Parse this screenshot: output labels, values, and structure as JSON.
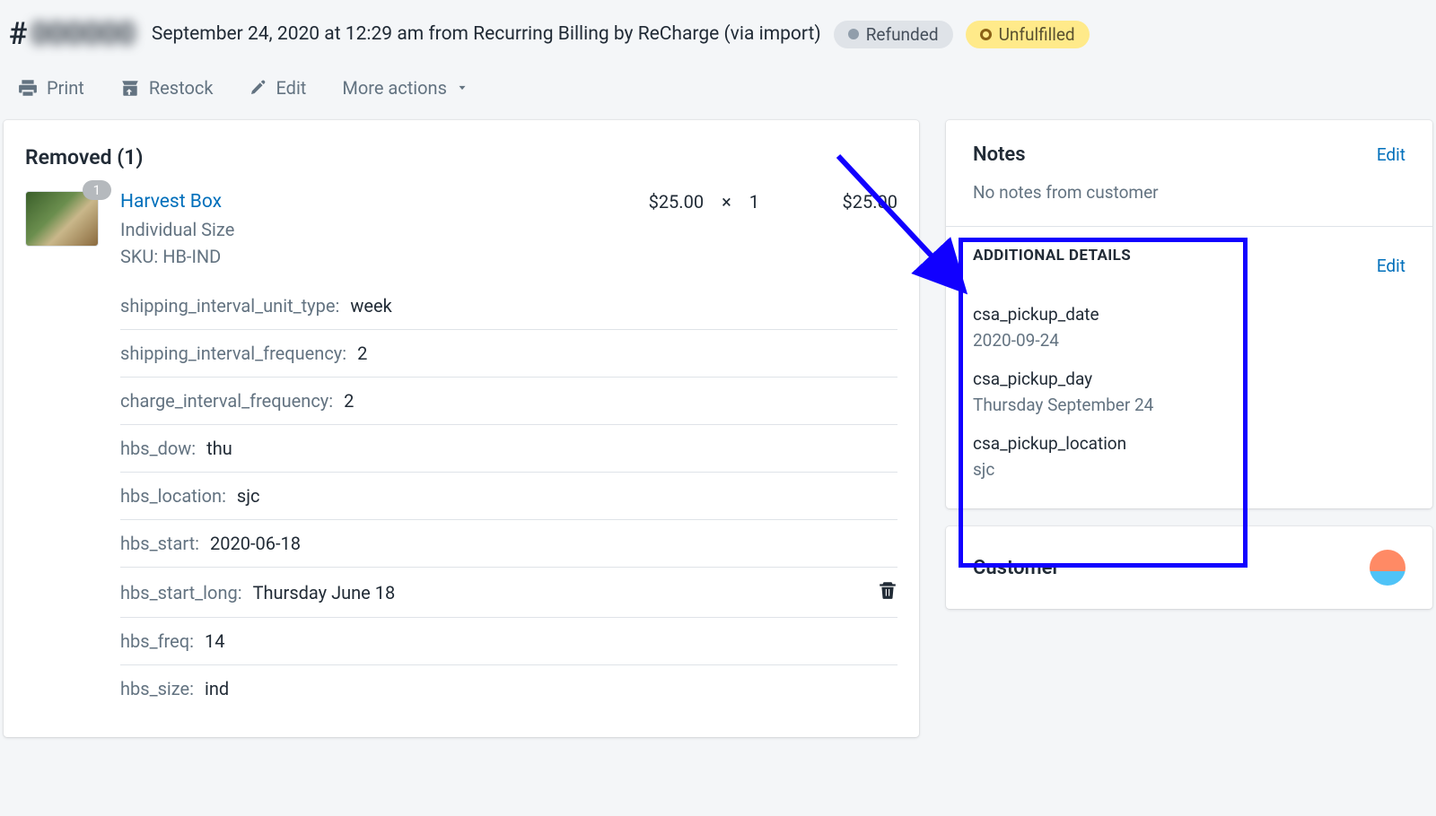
{
  "header": {
    "order_number_hash": "#",
    "order_number_blur": "000000",
    "subtitle": "September 24, 2020 at 12:29 am from Recurring Billing by ReCharge (via import)",
    "badge_refunded": "Refunded",
    "badge_unfulfilled": "Unfulfilled"
  },
  "toolbar": {
    "print": "Print",
    "restock": "Restock",
    "edit": "Edit",
    "more": "More actions"
  },
  "removed": {
    "title": "Removed (1)",
    "item": {
      "name": "Harvest Box",
      "variant": "Individual Size",
      "sku": "SKU: HB-IND",
      "price": "$25.00",
      "times": "×",
      "qty": "1",
      "total": "$25.00",
      "badge": "1"
    },
    "props": [
      {
        "key": "shipping_interval_unit_type:",
        "val": "week"
      },
      {
        "key": "shipping_interval_frequency:",
        "val": "2"
      },
      {
        "key": "charge_interval_frequency:",
        "val": "2"
      },
      {
        "key": "hbs_dow:",
        "val": "thu"
      },
      {
        "key": "hbs_location:",
        "val": "sjc"
      },
      {
        "key": "hbs_start:",
        "val": "2020-06-18"
      },
      {
        "key": "hbs_start_long:",
        "val": "Thursday June 18"
      },
      {
        "key": "hbs_freq:",
        "val": "14"
      },
      {
        "key": "hbs_size:",
        "val": "ind"
      }
    ]
  },
  "notes": {
    "title": "Notes",
    "edit": "Edit",
    "body": "No notes from customer"
  },
  "additional": {
    "title": "ADDITIONAL DETAILS",
    "edit": "Edit",
    "items": [
      {
        "key": "csa_pickup_date",
        "val": "2020-09-24"
      },
      {
        "key": "csa_pickup_day",
        "val": "Thursday September 24"
      },
      {
        "key": "csa_pickup_location",
        "val": "sjc"
      }
    ]
  },
  "customer": {
    "title": "Customer"
  }
}
